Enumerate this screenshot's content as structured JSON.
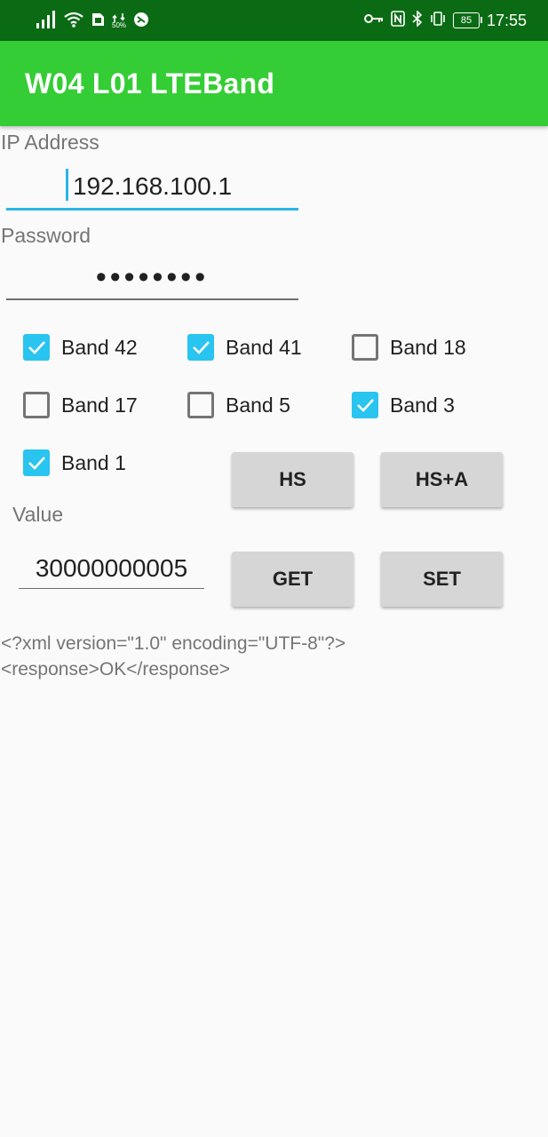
{
  "status_bar": {
    "time": "17:55",
    "battery": "85",
    "data_speed": "50%"
  },
  "app": {
    "title": "W04 L01 LTEBand"
  },
  "ip": {
    "label": "IP Address",
    "value": "192.168.100.1"
  },
  "password": {
    "label": "Password",
    "masked": "••••••••"
  },
  "bands": [
    {
      "label": "Band 42",
      "checked": true
    },
    {
      "label": "Band 41",
      "checked": true
    },
    {
      "label": "Band 18",
      "checked": false
    },
    {
      "label": "Band 17",
      "checked": false
    },
    {
      "label": "Band 5",
      "checked": false
    },
    {
      "label": "Band 3",
      "checked": true
    },
    {
      "label": "Band 1",
      "checked": true
    }
  ],
  "buttons": {
    "hs": "HS",
    "hs_a": "HS+A",
    "get": "GET",
    "set": "SET"
  },
  "value": {
    "label": "Value",
    "value": "30000000005"
  },
  "response": {
    "line1": "<?xml version=\"1.0\" encoding=\"UTF-8\"?>",
    "line2": "<response>OK</response>"
  },
  "colors": {
    "app_bar": "#35cd35",
    "status_bar": "#0b6b14",
    "accent": "#29c4f0"
  }
}
